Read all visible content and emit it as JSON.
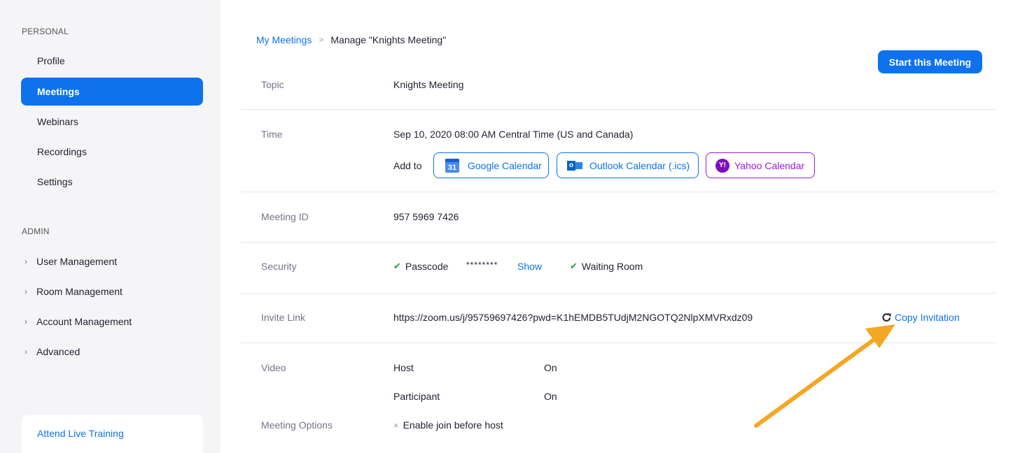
{
  "sidebar": {
    "personal_label": "PERSONAL",
    "personal_items": [
      {
        "label": "Profile"
      },
      {
        "label": "Meetings"
      },
      {
        "label": "Webinars"
      },
      {
        "label": "Recordings"
      },
      {
        "label": "Settings"
      }
    ],
    "active_item": "Meetings",
    "admin_label": "ADMIN",
    "admin_items": [
      {
        "label": "User Management"
      },
      {
        "label": "Room Management"
      },
      {
        "label": "Account Management"
      },
      {
        "label": "Advanced"
      }
    ],
    "training_label": "Attend Live Training"
  },
  "breadcrumb": {
    "parent": "My Meetings",
    "separator": ">",
    "current": "Manage \"Knights Meeting\""
  },
  "start_button": "Start this Meeting",
  "rows": {
    "topic": {
      "label": "Topic",
      "value": "Knights Meeting"
    },
    "time": {
      "label": "Time",
      "value": "Sep 10, 2020 08:00 AM Central Time (US and Canada)",
      "add_to": "Add to",
      "google": "Google Calendar",
      "google_icon_text": "31",
      "outlook": "Outlook Calendar (.ics)",
      "outlook_icon_text": "o",
      "yahoo": "Yahoo Calendar",
      "yahoo_icon_text": "Y!"
    },
    "meeting_id": {
      "label": "Meeting ID",
      "value": "957 5969 7426"
    },
    "security": {
      "label": "Security",
      "passcode": "Passcode",
      "masked": "********",
      "show": "Show",
      "waiting_room": "Waiting Room"
    },
    "invite": {
      "label": "Invite Link",
      "url": "https://zoom.us/j/95759697426?pwd=K1hEMDB5TUdjM2NGOTQ2NlpXMVRxdz09",
      "copy": "Copy Invitation"
    },
    "video": {
      "label": "Video",
      "host_label": "Host",
      "host_value": "On",
      "participant_label": "Participant",
      "participant_value": "On"
    },
    "options": {
      "label": "Meeting Options",
      "join_before_host": "Enable join before host"
    }
  },
  "colors": {
    "accent": "#0e72ed",
    "yahoo": "#9b1dc9",
    "check": "#23a04d",
    "arrow": "#f5a623"
  }
}
